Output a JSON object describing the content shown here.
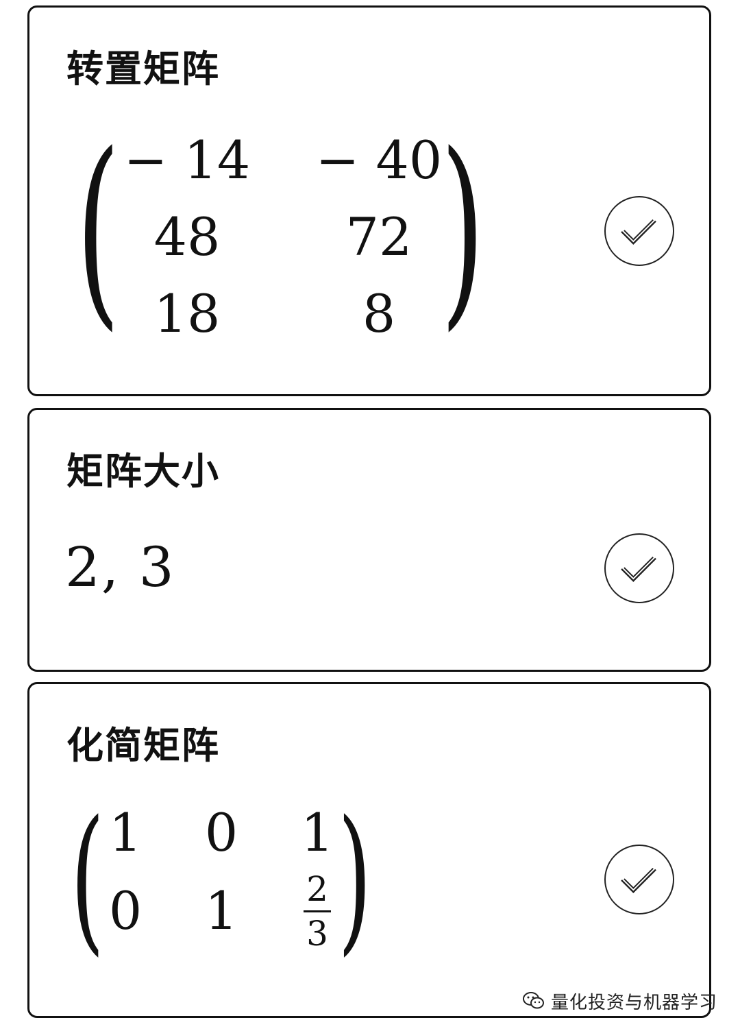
{
  "cards": [
    {
      "title": "转置矩阵",
      "matrix": [
        [
          "− 14",
          "− 40"
        ],
        [
          "48",
          "72"
        ],
        [
          "18",
          "8"
        ]
      ],
      "action_icon": "check-circle-icon"
    },
    {
      "title": "矩阵大小",
      "value": "2, 3",
      "action_icon": "check-circle-icon"
    },
    {
      "title": "化简矩阵",
      "matrix": [
        [
          "1",
          "0",
          "1"
        ],
        [
          "0",
          "1",
          {
            "numerator": "2",
            "denominator": "3"
          }
        ]
      ],
      "action_icon": "check-circle-icon"
    }
  ],
  "watermark": {
    "icon": "wechat-icon",
    "text": "量化投资与机器学习"
  }
}
